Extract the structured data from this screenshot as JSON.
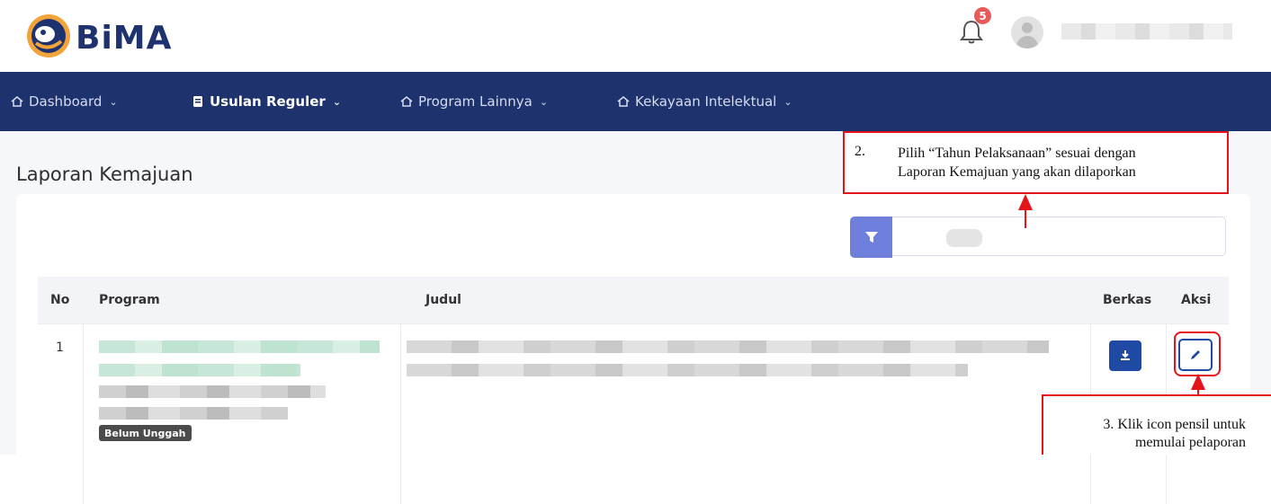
{
  "app": {
    "logo_text": "BiMA"
  },
  "header": {
    "notification_count": "5"
  },
  "nav": {
    "items": [
      {
        "label": "Dashboard"
      },
      {
        "label": "Usulan Reguler"
      },
      {
        "label": "Program Lainnya"
      },
      {
        "label": "Kekayaan Intelektual"
      }
    ],
    "active_index": 1
  },
  "page": {
    "title": "Laporan Kemajuan"
  },
  "table": {
    "columns": [
      "No",
      "Program",
      "Judul",
      "Berkas",
      "Aksi"
    ],
    "rows": [
      {
        "no": "1",
        "status": "Belum Unggah"
      }
    ]
  },
  "annotations": {
    "step2_number": "2.",
    "step2_line1": "Pilih “Tahun Pelaksanaan” sesuai dengan",
    "step2_line2": "Laporan Kemajuan yang akan dilaporkan",
    "step3_line1": "3. Klik icon pensil untuk",
    "step3_line2": "memulai pelaporan"
  },
  "colors": {
    "navbar": "#1e326e",
    "brand": "#1e3270",
    "filter_button": "#6f7fdc",
    "action_button": "#1f4aa3",
    "annotation": "#e5141b",
    "badge": "#e85a5a"
  }
}
